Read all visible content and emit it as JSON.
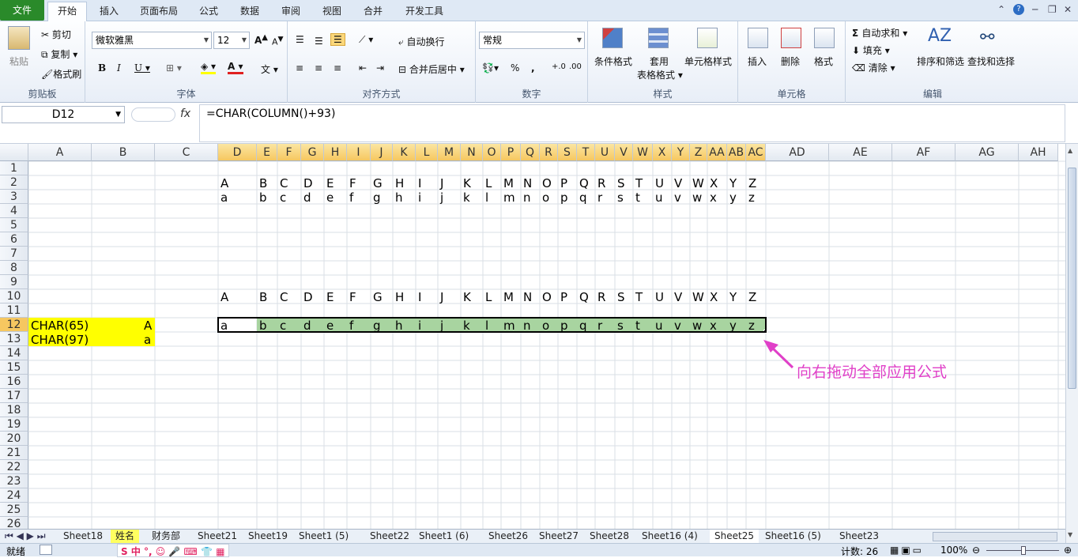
{
  "ribbon_tabs": [
    "文件",
    "开始",
    "插入",
    "页面布局",
    "公式",
    "数据",
    "审阅",
    "视图",
    "合并",
    "开发工具"
  ],
  "clipboard": {
    "paste": "粘贴",
    "cut": "剪切",
    "copy": "复制",
    "format_painter": "格式刷",
    "group": "剪贴板"
  },
  "font": {
    "name": "微软雅黑",
    "size": "12",
    "group": "字体"
  },
  "alignment": {
    "wrap": "自动换行",
    "merge": "合并后居中",
    "group": "对齐方式"
  },
  "number": {
    "format": "常规",
    "group": "数字"
  },
  "styles": {
    "cond": "条件格式",
    "table": "套用",
    "table2": "表格格式",
    "cell": "单元格样式",
    "group": "样式"
  },
  "cells": {
    "insert": "插入",
    "delete": "删除",
    "format": "格式",
    "group": "单元格"
  },
  "editing": {
    "autosum": "自动求和",
    "fill": "填充",
    "clear": "清除",
    "sort": "排序和筛选",
    "find": "查找和选择",
    "group": "编辑"
  },
  "formula_bar": {
    "name_box": "D12",
    "fx": "fx",
    "formula": "=CHAR(COLUMN()+93)"
  },
  "columns": [
    "A",
    "B",
    "C",
    "D",
    "E",
    "F",
    "G",
    "H",
    "I",
    "J",
    "K",
    "L",
    "M",
    "N",
    "O",
    "P",
    "Q",
    "R",
    "S",
    "T",
    "U",
    "V",
    "W",
    "X",
    "Y",
    "Z",
    "AA",
    "AB",
    "AC",
    "AD",
    "AE",
    "AF",
    "AG",
    "AH"
  ],
  "rows": [
    "1",
    "2",
    "3",
    "4",
    "5",
    "6",
    "7",
    "8",
    "9",
    "10",
    "11",
    "12",
    "13",
    "14",
    "15",
    "16",
    "17",
    "18",
    "19",
    "20",
    "21",
    "22",
    "23",
    "24",
    "25",
    "26"
  ],
  "upper": [
    "A",
    "B",
    "C",
    "D",
    "E",
    "F",
    "G",
    "H",
    "I",
    "J",
    "K",
    "L",
    "M",
    "N",
    "O",
    "P",
    "Q",
    "R",
    "S",
    "T",
    "U",
    "V",
    "W",
    "X",
    "Y",
    "Z"
  ],
  "lower": [
    "a",
    "b",
    "c",
    "d",
    "e",
    "f",
    "g",
    "h",
    "i",
    "j",
    "k",
    "l",
    "m",
    "n",
    "o",
    "p",
    "q",
    "r",
    "s",
    "t",
    "u",
    "v",
    "w",
    "x",
    "y",
    "z"
  ],
  "a12": "CHAR(65)",
  "b12": "A",
  "a13": "CHAR(97)",
  "b13": "a",
  "annotation": "向右拖动全部应用公式",
  "sheet_tabs": [
    "Sheet18",
    "姓名",
    "财务部",
    "Sheet21",
    "Sheet19",
    "Sheet1 (5)",
    "Sheet22",
    "Sheet1 (6)",
    "Sheet26",
    "Sheet27",
    "Sheet28",
    "Sheet16 (4)",
    "Sheet25",
    "Sheet16 (5)",
    "Sheet23"
  ],
  "status": {
    "ready": "就绪",
    "count": "计数: 26",
    "zoom": "100%"
  },
  "colors": {
    "selected_header": "#f6c760",
    "highlight": "#ffff00",
    "fill_green": "#a8d4a0",
    "arrow": "#e040c8"
  }
}
